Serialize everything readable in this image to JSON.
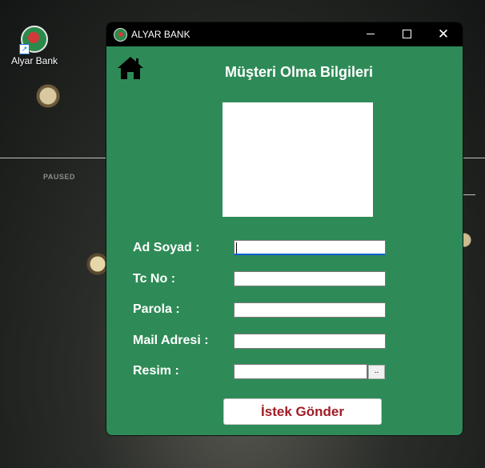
{
  "desktop": {
    "shortcut_label": "Alyar Bank",
    "paused_text": "PAUSED"
  },
  "window": {
    "title": "ALYAR BANK",
    "controls": {
      "minimize": "minimize",
      "maximize": "maximize",
      "close": "✕"
    }
  },
  "form": {
    "title": "Müşteri Olma Bilgileri",
    "home_icon": "home-icon",
    "fields": [
      {
        "label": "Ad Soyad :",
        "value": ""
      },
      {
        "label": "Tc No :",
        "value": ""
      },
      {
        "label": "Parola :",
        "value": ""
      },
      {
        "label": "Mail Adresi :",
        "value": ""
      },
      {
        "label": "Resim :",
        "value": ""
      }
    ],
    "browse_label": "..",
    "submit_label": "İstek Gönder"
  },
  "colors": {
    "form_background": "#2E8B57",
    "title_bar": "#000000",
    "submit_text": "#A01C24"
  }
}
